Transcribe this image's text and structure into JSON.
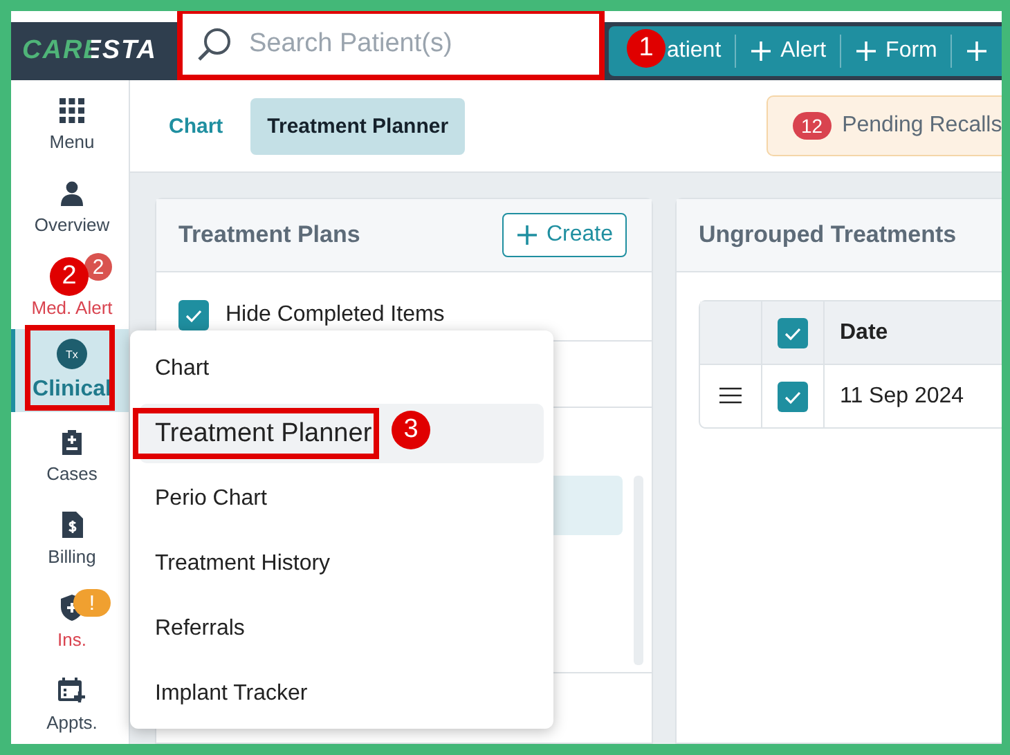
{
  "header": {
    "logo": "CARESTA",
    "search": {
      "placeholder": "Search Patient(s)",
      "highlighted": true
    },
    "actions": [
      {
        "kind": "text",
        "label": "atient"
      },
      {
        "kind": "text",
        "label": "Alert"
      },
      {
        "kind": "text",
        "label": "Form"
      },
      {
        "kind": "clipped"
      }
    ]
  },
  "sidebar": {
    "items": [
      {
        "label": "Menu",
        "alert": false,
        "selected": false,
        "highlighted": false
      },
      {
        "label": "Overview",
        "alert": false,
        "selected": false,
        "highlighted": false
      },
      {
        "label": "Med. Alert",
        "alert": true,
        "selected": false,
        "highlighted": false,
        "badge": {
          "text": "2",
          "color": "#d9534f"
        }
      },
      {
        "label": "Clinical",
        "icon_text": "Tx",
        "alert": false,
        "selected": true,
        "highlighted": true
      },
      {
        "label": "Cases",
        "alert": false,
        "selected": false,
        "highlighted": false
      },
      {
        "label": "Billing",
        "alert": false,
        "selected": false,
        "highlighted": false
      },
      {
        "label": "Ins.",
        "alert": true,
        "selected": false,
        "highlighted": false,
        "badge": {
          "text": "!",
          "color": "#f0a030"
        }
      },
      {
        "label": "Appts.",
        "alert": false,
        "selected": false,
        "highlighted": false
      }
    ]
  },
  "tabs": [
    {
      "label": "Chart",
      "selected": false
    },
    {
      "label": "Treatment Planner",
      "selected": true
    }
  ],
  "recalls": {
    "count": "12",
    "label": "Pending Recalls"
  },
  "treatment_plans": {
    "title": "Treatment Plans",
    "create_button": "Create",
    "hide_completed": {
      "label": "Hide Completed Items",
      "checked": true
    }
  },
  "ungrouped": {
    "title": "Ungrouped Treatments",
    "header_checked": true,
    "columns": [
      "Date"
    ],
    "rows": [
      {
        "checked": true,
        "date": "11 Sep 2024"
      }
    ]
  },
  "menu": {
    "items": [
      {
        "label": "Chart",
        "selected": false,
        "highlighted": false
      },
      {
        "label": "Treatment Planner",
        "selected": true,
        "highlighted": true
      },
      {
        "label": "Perio Chart",
        "selected": false,
        "highlighted": false
      },
      {
        "label": "Treatment History",
        "selected": false,
        "highlighted": false
      },
      {
        "label": "Referrals",
        "selected": false,
        "highlighted": false
      },
      {
        "label": "Implant Tracker",
        "selected": false,
        "highlighted": false
      }
    ]
  },
  "annotations": [
    {
      "number": "1"
    },
    {
      "number": "2"
    },
    {
      "number": "3"
    }
  ]
}
